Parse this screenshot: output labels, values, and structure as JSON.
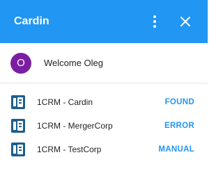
{
  "header": {
    "title": "Cardin",
    "menu_icon": "more-vert-icon",
    "close_icon": "close-icon",
    "background_color": "#2196f3"
  },
  "welcome": {
    "avatar_initial": "O",
    "avatar_color": "#7b1fa2",
    "text": "Welcome Oleg"
  },
  "connections": [
    {
      "icon": "crm-app-icon",
      "label": "1CRM - Cardin",
      "status": "FOUND"
    },
    {
      "icon": "crm-app-icon",
      "label": "1CRM - MergerCorp",
      "status": "ERROR"
    },
    {
      "icon": "crm-app-icon",
      "label": "1CRM - TestCorp",
      "status": "MANUAL"
    }
  ],
  "status_color": "#2196f3"
}
